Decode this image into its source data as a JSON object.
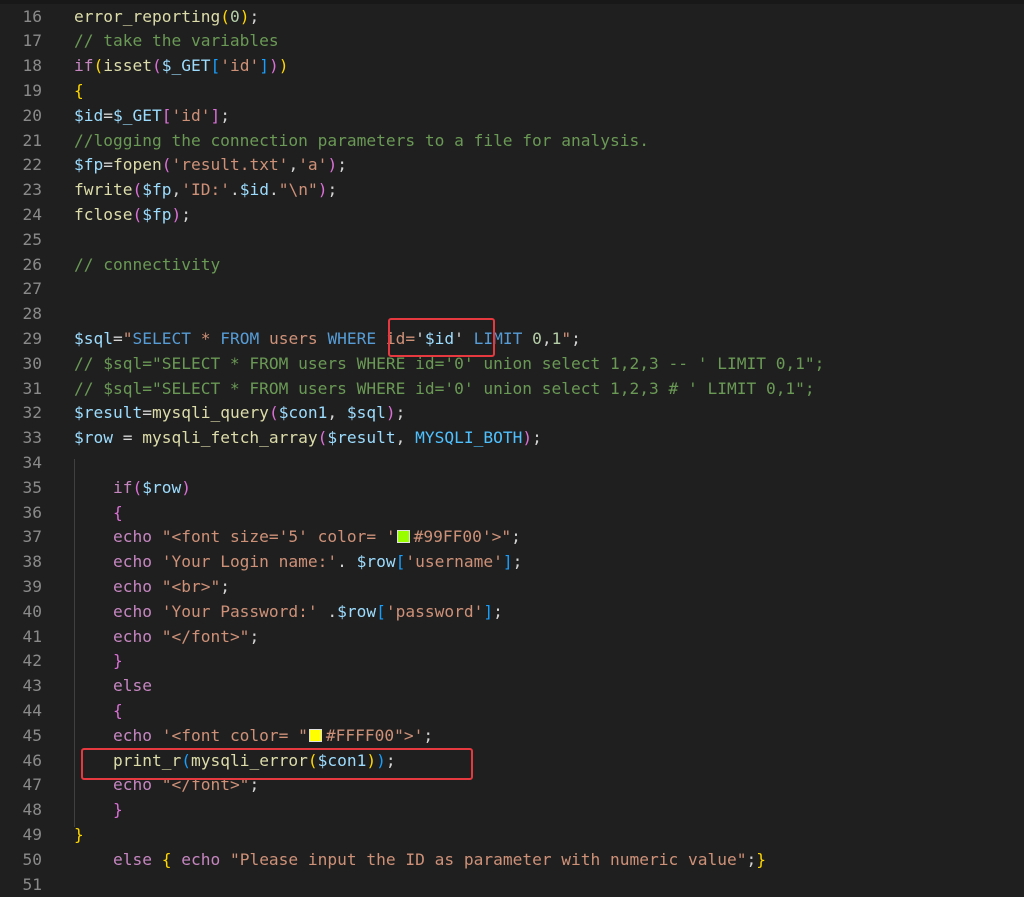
{
  "editor": {
    "lines": [
      {
        "num": "16",
        "code": [
          {
            "t": "error_reporting",
            "c": "k-fn"
          },
          {
            "t": "(",
            "c": "k-b1"
          },
          {
            "t": "0",
            "c": "k-num"
          },
          {
            "t": ")",
            "c": "k-b1"
          },
          {
            "t": ";"
          }
        ]
      },
      {
        "num": "17",
        "code": [
          {
            "t": "// take the variables",
            "c": "k-com"
          }
        ]
      },
      {
        "num": "18",
        "code": [
          {
            "t": "if",
            "c": "k-kw"
          },
          {
            "t": "(",
            "c": "k-b1"
          },
          {
            "t": "isset",
            "c": "k-fn"
          },
          {
            "t": "(",
            "c": "k-b2"
          },
          {
            "t": "$_GET",
            "c": "k-var"
          },
          {
            "t": "[",
            "c": "k-b3"
          },
          {
            "t": "'id'",
            "c": "k-str"
          },
          {
            "t": "]",
            "c": "k-b3"
          },
          {
            "t": ")",
            "c": "k-b2"
          },
          {
            "t": ")",
            "c": "k-b1"
          }
        ]
      },
      {
        "num": "19",
        "code": [
          {
            "t": "{",
            "c": "k-b1"
          }
        ]
      },
      {
        "num": "20",
        "code": [
          {
            "t": "$id",
            "c": "k-var"
          },
          {
            "t": "="
          },
          {
            "t": "$_GET",
            "c": "k-var"
          },
          {
            "t": "[",
            "c": "k-b2"
          },
          {
            "t": "'id'",
            "c": "k-str"
          },
          {
            "t": "]",
            "c": "k-b2"
          },
          {
            "t": ";"
          }
        ]
      },
      {
        "num": "21",
        "code": [
          {
            "t": "//logging the connection parameters to a file for analysis.",
            "c": "k-com"
          }
        ]
      },
      {
        "num": "22",
        "code": [
          {
            "t": "$fp",
            "c": "k-var"
          },
          {
            "t": "="
          },
          {
            "t": "fopen",
            "c": "k-fn"
          },
          {
            "t": "(",
            "c": "k-b2"
          },
          {
            "t": "'result.txt'",
            "c": "k-str"
          },
          {
            "t": ","
          },
          {
            "t": "'a'",
            "c": "k-str"
          },
          {
            "t": ")",
            "c": "k-b2"
          },
          {
            "t": ";"
          }
        ]
      },
      {
        "num": "23",
        "code": [
          {
            "t": "fwrite",
            "c": "k-fn"
          },
          {
            "t": "(",
            "c": "k-b2"
          },
          {
            "t": "$fp",
            "c": "k-var"
          },
          {
            "t": ","
          },
          {
            "t": "'ID:'",
            "c": "k-str"
          },
          {
            "t": "."
          },
          {
            "t": "$id",
            "c": "k-var"
          },
          {
            "t": "."
          },
          {
            "t": "\"\\n\"",
            "c": "k-str"
          },
          {
            "t": ")",
            "c": "k-b2"
          },
          {
            "t": ";"
          }
        ]
      },
      {
        "num": "24",
        "code": [
          {
            "t": "fclose",
            "c": "k-fn"
          },
          {
            "t": "(",
            "c": "k-b2"
          },
          {
            "t": "$fp",
            "c": "k-var"
          },
          {
            "t": ")",
            "c": "k-b2"
          },
          {
            "t": ";"
          }
        ]
      },
      {
        "num": "25",
        "code": []
      },
      {
        "num": "26",
        "code": [
          {
            "t": "// connectivity",
            "c": "k-com"
          }
        ]
      },
      {
        "num": "27",
        "code": []
      },
      {
        "num": "28",
        "code": []
      },
      {
        "num": "29",
        "code": [
          {
            "t": "$sql",
            "c": "k-var"
          },
          {
            "t": "="
          },
          {
            "t": "\"",
            "c": "k-str"
          },
          {
            "t": "SELECT",
            "c": "k-sql"
          },
          {
            "t": " * ",
            "c": "k-str"
          },
          {
            "t": "FROM",
            "c": "k-sql"
          },
          {
            "t": " users ",
            "c": "k-str"
          },
          {
            "t": "WHERE",
            "c": "k-sql"
          },
          {
            "t": " id=",
            "c": "k-str"
          },
          {
            "t": "'"
          },
          {
            "t": "$id",
            "c": "k-var"
          },
          {
            "t": "'"
          },
          {
            "t": " ",
            "c": "k-str"
          },
          {
            "t": "LIMIT",
            "c": "k-sql"
          },
          {
            "t": " "
          },
          {
            "t": "0",
            "c": "k-num"
          },
          {
            "t": ","
          },
          {
            "t": "1",
            "c": "k-num"
          },
          {
            "t": "\"",
            "c": "k-str"
          },
          {
            "t": ";"
          }
        ]
      },
      {
        "num": "30",
        "code": [
          {
            "t": "// $sql=\"SELECT * FROM users WHERE id='0' union select 1,2,3 -- ' LIMIT 0,1\";",
            "c": "k-com"
          }
        ]
      },
      {
        "num": "31",
        "code": [
          {
            "t": "// $sql=\"SELECT * FROM users WHERE id='0' union select 1,2,3 # ' LIMIT 0,1\";",
            "c": "k-com"
          }
        ]
      },
      {
        "num": "32",
        "code": [
          {
            "t": "$result",
            "c": "k-var"
          },
          {
            "t": "="
          },
          {
            "t": "mysqli_query",
            "c": "k-fn"
          },
          {
            "t": "(",
            "c": "k-b2"
          },
          {
            "t": "$con1",
            "c": "k-var"
          },
          {
            "t": ", "
          },
          {
            "t": "$sql",
            "c": "k-var"
          },
          {
            "t": ")",
            "c": "k-b2"
          },
          {
            "t": ";"
          }
        ]
      },
      {
        "num": "33",
        "code": [
          {
            "t": "$row",
            "c": "k-var"
          },
          {
            "t": " = "
          },
          {
            "t": "mysqli_fetch_array",
            "c": "k-fn"
          },
          {
            "t": "(",
            "c": "k-b2"
          },
          {
            "t": "$result",
            "c": "k-var"
          },
          {
            "t": ", "
          },
          {
            "t": "MYSQLI_BOTH",
            "c": "k-const"
          },
          {
            "t": ")",
            "c": "k-b2"
          },
          {
            "t": ";"
          }
        ]
      },
      {
        "num": "34",
        "code": []
      },
      {
        "num": "35",
        "code": [
          {
            "t": "    "
          },
          {
            "t": "if",
            "c": "k-kw"
          },
          {
            "t": "(",
            "c": "k-b2"
          },
          {
            "t": "$row",
            "c": "k-var"
          },
          {
            "t": ")",
            "c": "k-b2"
          }
        ]
      },
      {
        "num": "36",
        "code": [
          {
            "t": "    "
          },
          {
            "t": "{",
            "c": "k-b2"
          }
        ]
      },
      {
        "num": "37",
        "code": [
          {
            "t": "    "
          },
          {
            "t": "echo",
            "c": "k-kw"
          },
          {
            "t": " "
          },
          {
            "t": "\"<font size='5' color= '",
            "c": "k-str"
          },
          {
            "t": "",
            "swatch": "#99FF00"
          },
          {
            "t": "#99FF00'>\"",
            "c": "k-str"
          },
          {
            "t": ";"
          }
        ]
      },
      {
        "num": "38",
        "code": [
          {
            "t": "    "
          },
          {
            "t": "echo",
            "c": "k-kw"
          },
          {
            "t": " "
          },
          {
            "t": "'Your Login name:'",
            "c": "k-str"
          },
          {
            "t": ". "
          },
          {
            "t": "$row",
            "c": "k-var"
          },
          {
            "t": "[",
            "c": "k-b3"
          },
          {
            "t": "'username'",
            "c": "k-str"
          },
          {
            "t": "]",
            "c": "k-b3"
          },
          {
            "t": ";"
          }
        ]
      },
      {
        "num": "39",
        "code": [
          {
            "t": "    "
          },
          {
            "t": "echo",
            "c": "k-kw"
          },
          {
            "t": " "
          },
          {
            "t": "\"<br>\"",
            "c": "k-str"
          },
          {
            "t": ";"
          }
        ]
      },
      {
        "num": "40",
        "code": [
          {
            "t": "    "
          },
          {
            "t": "echo",
            "c": "k-kw"
          },
          {
            "t": " "
          },
          {
            "t": "'Your Password:'",
            "c": "k-str"
          },
          {
            "t": " ."
          },
          {
            "t": "$row",
            "c": "k-var"
          },
          {
            "t": "[",
            "c": "k-b3"
          },
          {
            "t": "'password'",
            "c": "k-str"
          },
          {
            "t": "]",
            "c": "k-b3"
          },
          {
            "t": ";"
          }
        ]
      },
      {
        "num": "41",
        "code": [
          {
            "t": "    "
          },
          {
            "t": "echo",
            "c": "k-kw"
          },
          {
            "t": " "
          },
          {
            "t": "\"</font>\"",
            "c": "k-str"
          },
          {
            "t": ";"
          }
        ]
      },
      {
        "num": "42",
        "code": [
          {
            "t": "    "
          },
          {
            "t": "}",
            "c": "k-b2"
          }
        ]
      },
      {
        "num": "43",
        "code": [
          {
            "t": "    "
          },
          {
            "t": "else",
            "c": "k-kw"
          }
        ]
      },
      {
        "num": "44",
        "code": [
          {
            "t": "    "
          },
          {
            "t": "{",
            "c": "k-b2"
          }
        ]
      },
      {
        "num": "45",
        "code": [
          {
            "t": "    "
          },
          {
            "t": "echo",
            "c": "k-kw"
          },
          {
            "t": " "
          },
          {
            "t": "'<font color= \"",
            "c": "k-str"
          },
          {
            "t": "",
            "swatch": "#FFFF00"
          },
          {
            "t": "#FFFF00\">'",
            "c": "k-str"
          },
          {
            "t": ";"
          }
        ]
      },
      {
        "num": "46",
        "code": [
          {
            "t": "    "
          },
          {
            "t": "print_r",
            "c": "k-fn"
          },
          {
            "t": "(",
            "c": "k-b3"
          },
          {
            "t": "mysqli_error",
            "c": "k-fn"
          },
          {
            "t": "(",
            "c": "k-b1"
          },
          {
            "t": "$con1",
            "c": "k-var"
          },
          {
            "t": ")",
            "c": "k-b1"
          },
          {
            "t": ")",
            "c": "k-b3"
          },
          {
            "t": ";"
          }
        ]
      },
      {
        "num": "47",
        "code": [
          {
            "t": "    "
          },
          {
            "t": "echo",
            "c": "k-kw"
          },
          {
            "t": " "
          },
          {
            "t": "\"</font>\"",
            "c": "k-str"
          },
          {
            "t": ";"
          }
        ]
      },
      {
        "num": "48",
        "code": [
          {
            "t": "    "
          },
          {
            "t": "}",
            "c": "k-b2"
          }
        ]
      },
      {
        "num": "49",
        "code": [
          {
            "t": "}",
            "c": "k-b1"
          }
        ]
      },
      {
        "num": "50",
        "code": [
          {
            "t": "    "
          },
          {
            "t": "else",
            "c": "k-kw"
          },
          {
            "t": " "
          },
          {
            "t": "{",
            "c": "k-b1"
          },
          {
            "t": " "
          },
          {
            "t": "echo",
            "c": "k-kw"
          },
          {
            "t": " "
          },
          {
            "t": "\"Please input the ID as parameter with numeric value\"",
            "c": "k-str"
          },
          {
            "t": ";"
          },
          {
            "t": "}",
            "c": "k-b1"
          }
        ]
      },
      {
        "num": "51",
        "code": []
      }
    ]
  }
}
